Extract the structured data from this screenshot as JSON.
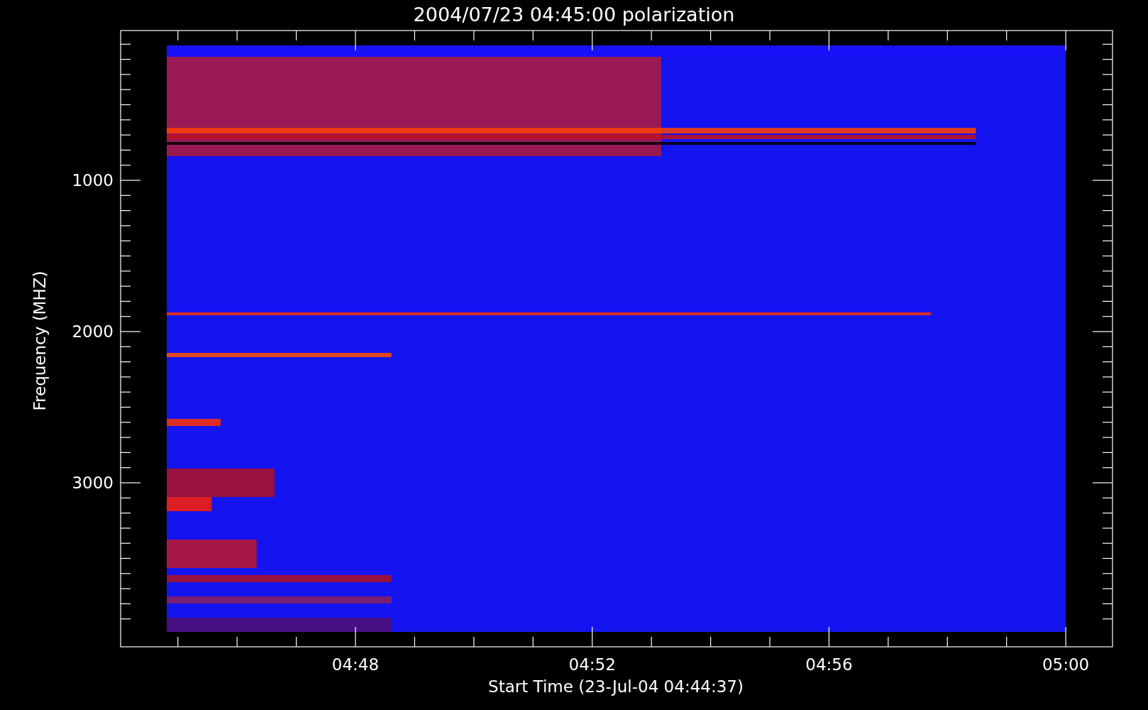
{
  "title": "2004/07/23 04:45:00 polarization",
  "ylabel": "Frequency (MHZ)",
  "xlabel": "Start Time (23-Jul-04 04:44:37)",
  "yticks": [
    "1000",
    "2000",
    "3000"
  ],
  "xticks": [
    "04:48",
    "04:52",
    "04:56",
    "05:00"
  ]
}
